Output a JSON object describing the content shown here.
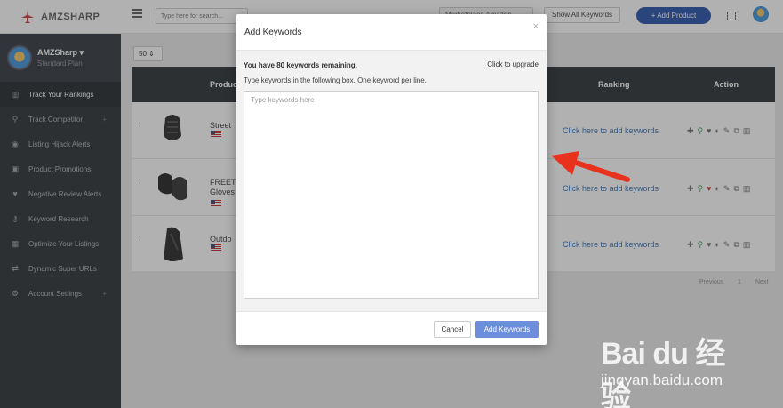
{
  "app": {
    "brand": "AMZSHARP"
  },
  "header": {
    "search_placeholder": "Type here for search...",
    "market_select": "Marketplace Amazon",
    "show_all_label": "Show All Keywords",
    "add_product_label": "+ Add Product"
  },
  "profile": {
    "name": "AMZSharp ▾",
    "plan": "Standard Plan"
  },
  "sidebar": {
    "items": [
      {
        "label": "Track Your Rankings",
        "icon": "bar-chart-icon",
        "glyph": "▥"
      },
      {
        "label": "Track Competitor",
        "icon": "search-icon",
        "glyph": "⚲"
      },
      {
        "label": "Listing Hijack Alerts",
        "icon": "eye-slash-icon",
        "glyph": "◉"
      },
      {
        "label": "Product Promotions",
        "icon": "gift-icon",
        "glyph": "▣"
      },
      {
        "label": "Negative Review Alerts",
        "icon": "heart-icon",
        "glyph": "♥"
      },
      {
        "label": "Keyword Research",
        "icon": "key-icon",
        "glyph": "⚷"
      },
      {
        "label": "Optimize Your Listings",
        "icon": "building-icon",
        "glyph": "▦"
      },
      {
        "label": "Dynamic Super URLs",
        "icon": "shuffle-icon",
        "glyph": "⇄"
      },
      {
        "label": "Account Settings",
        "icon": "gear-icon",
        "glyph": "⚙"
      }
    ]
  },
  "table": {
    "per_page": "50 ⇕",
    "columns": {
      "product": "Product",
      "ranking": "Ranking",
      "action": "Action"
    },
    "rows": [
      {
        "title": "Street",
        "title2": "",
        "rank_link": "Click here to add keywords"
      },
      {
        "title": "FREETO",
        "title2": "Gloves",
        "rank_link": "Click here to add keywords"
      },
      {
        "title": "Outdo",
        "title2": "",
        "rank_link": "Click here to add keywords"
      }
    ],
    "pager": {
      "previous": "Previous",
      "page": "1",
      "next": "Next"
    }
  },
  "modal": {
    "title": "Add Keywords",
    "close": "×",
    "remaining": "You have 80 keywords remaining.",
    "upgrade_link": "Click to upgrade",
    "instructions": "Type keywords in the following box. One keyword per line.",
    "textarea_placeholder": "Type keywords here",
    "cancel_label": "Cancel",
    "submit_label": "Add Keywords"
  },
  "watermark": {
    "logo": "Bai du 经验",
    "url": "jingyan.baidu.com"
  },
  "colors": {
    "sidebar": "#23282d",
    "accent": "#1f4aa7",
    "submit": "#6d8edc",
    "link": "#2c6cb6",
    "arrow": "#e8321e"
  }
}
